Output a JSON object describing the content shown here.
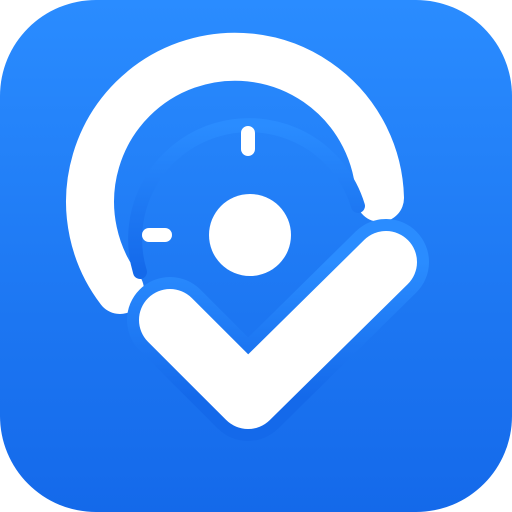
{
  "app_icon": {
    "icon": "target-check-icon",
    "colors": {
      "background_top": "#2A8CFF",
      "background_bottom": "#1469EA",
      "glyph": "#FFFFFF"
    }
  }
}
